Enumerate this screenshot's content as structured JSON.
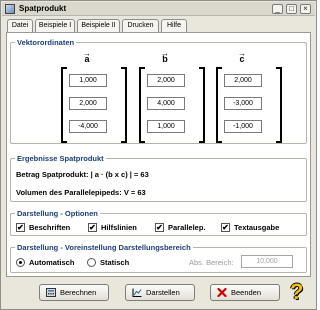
{
  "window": {
    "title": "Spatprodukt"
  },
  "menu": {
    "tabs": [
      "Datei",
      "Beispiele I",
      "Beispiele II",
      "Drucken",
      "Hilfe"
    ]
  },
  "vectors": {
    "group_title": "Vektorordinaten",
    "a": {
      "name": "a",
      "values": [
        "1,000",
        "2,000",
        "-4,000"
      ]
    },
    "b": {
      "name": "b",
      "values": [
        "2,000",
        "4,000",
        "1,000"
      ]
    },
    "c": {
      "name": "c",
      "values": [
        "2,000",
        "-3,000",
        "-1,000"
      ]
    }
  },
  "results": {
    "group_title": "Ergebnisse Spatprodukt",
    "betrag_prefix": "Betrag Spatprodukt: | a · (b x c) | = ",
    "betrag_value": "63",
    "volume_prefix": "Volumen des Parallelepipeds: V = ",
    "volume_value": "63"
  },
  "display_options": {
    "group_title": "Darstellung - Optionen",
    "items": [
      {
        "label": "Beschriften",
        "checked": true
      },
      {
        "label": "Hilfslinien",
        "checked": true
      },
      {
        "label": "Parallelep.",
        "checked": true
      },
      {
        "label": "Textausgabe",
        "checked": true
      }
    ]
  },
  "range_settings": {
    "group_title": "Darstellung - Voreinstellung Darstellungsbereich",
    "automatic_label": "Automatisch",
    "static_label": "Statisch",
    "selected": "Automatisch",
    "range_label": "Abs. Bereich:",
    "range_value": "10,000"
  },
  "buttons": {
    "compute": "Berechnen",
    "display": "Darstellen",
    "exit": "Beenden"
  },
  "icons": {
    "help": "question-mark-icon",
    "check_mark": "✔"
  }
}
